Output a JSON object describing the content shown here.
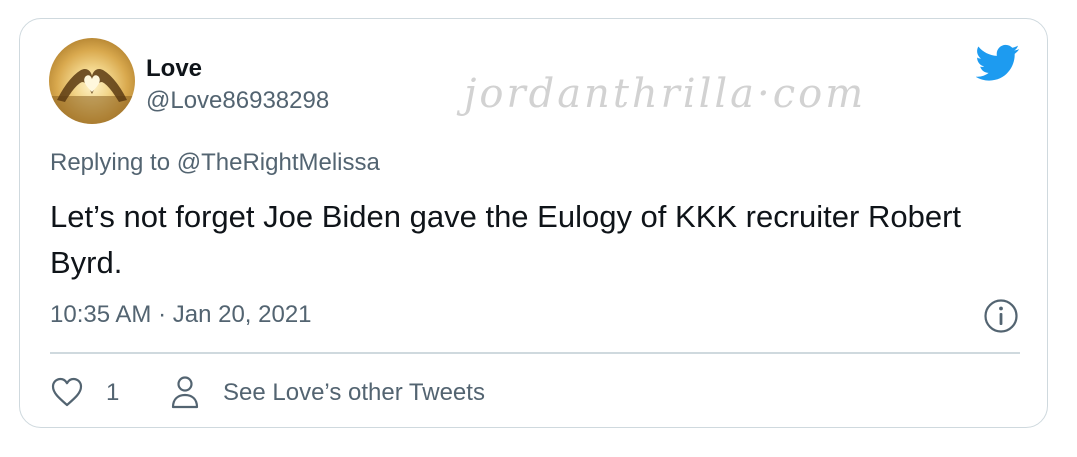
{
  "tweet": {
    "display_name": "Love",
    "handle": "@Love86938298",
    "replying_prefix": "Replying to",
    "replying_to": "@TheRightMelissa",
    "text": "Let’s not forget Joe Biden gave the Eulogy of KKK recruiter Robert Byrd.",
    "timestamp": "10:35 AM · Jan 20, 2021",
    "like_count": "1",
    "other_tweets_label": "See Love’s other Tweets"
  },
  "watermark": "jordanthrilla·com",
  "icons": {
    "brand": "twitter-bird-icon",
    "info": "info-icon",
    "like": "heart-icon",
    "profile": "person-icon"
  },
  "colors": {
    "twitter_blue": "#1d9bf0",
    "text_primary": "#0f1419",
    "text_secondary": "#536471",
    "border": "#cfd9de"
  }
}
